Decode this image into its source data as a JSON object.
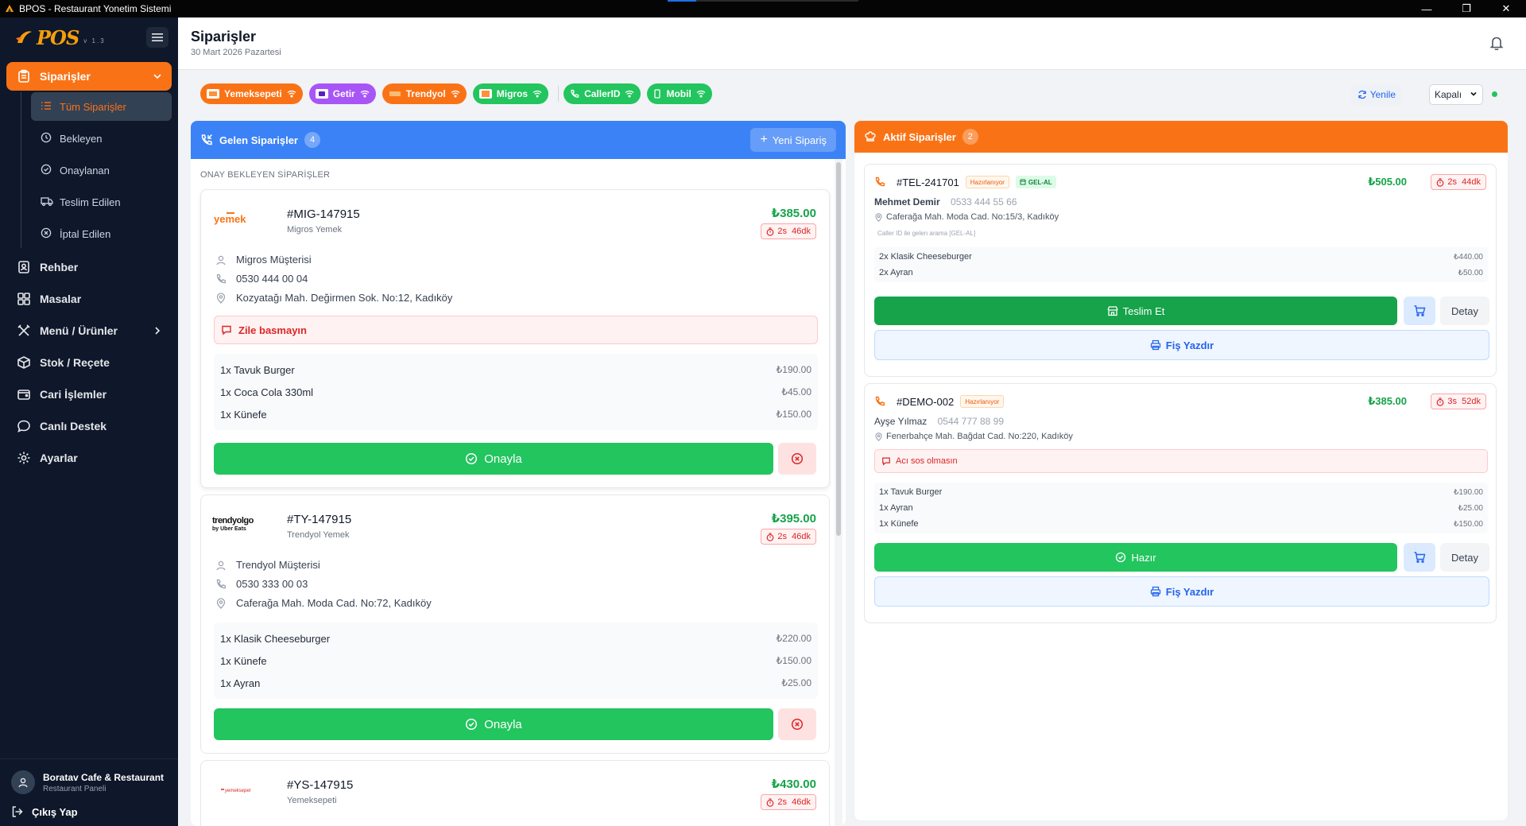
{
  "window": {
    "title": "BPOS - Restaurant Yonetim Sistemi",
    "load_progress": 0.15
  },
  "brand": {
    "logo": "POS",
    "version": "v 1.3"
  },
  "sidebar": {
    "items": [
      {
        "label": "Siparişler",
        "icon": "clipboard-icon",
        "active": true
      },
      {
        "label": "Rehber",
        "icon": "contact-book-icon"
      },
      {
        "label": "Masalar",
        "icon": "grid-icon"
      },
      {
        "label": "Menü / Ürünler",
        "icon": "utensils-icon"
      },
      {
        "label": "Stok / Reçete",
        "icon": "box-icon"
      },
      {
        "label": "Cari İşlemler",
        "icon": "wallet-icon"
      },
      {
        "label": "Canlı Destek",
        "icon": "chat-icon"
      },
      {
        "label": "Ayarlar",
        "icon": "gear-icon"
      }
    ],
    "subitems": [
      {
        "label": "Tüm Siparişler",
        "active": true
      },
      {
        "label": "Bekleyen"
      },
      {
        "label": "Onaylanan"
      },
      {
        "label": "Teslim Edilen"
      },
      {
        "label": "İptal Edilen"
      }
    ],
    "user": {
      "name": "Boratav Cafe & Restaurant",
      "role": "Restaurant Paneli"
    },
    "logout": "Çıkış Yap"
  },
  "header": {
    "title": "Siparişler",
    "date": "30 Mart 2026 Pazartesi"
  },
  "channels": [
    {
      "label": "Yemeksepeti",
      "color": "#f97316"
    },
    {
      "label": "Getir",
      "color": "#a855f7"
    },
    {
      "label": "Trendyol",
      "color": "#f97316"
    },
    {
      "label": "Migros",
      "color": "#22c55e"
    },
    {
      "label": "CallerID",
      "color": "#22c55e"
    },
    {
      "label": "Mobil",
      "color": "#22c55e"
    }
  ],
  "toolbar": {
    "refresh": "Yenile",
    "status": "Kapalı"
  },
  "incoming": {
    "title": "Gelen Siparişler",
    "count": "4",
    "new_order": "Yeni Sipariş",
    "section": "ONAY BEKLEYEN SİPARİŞLER",
    "approve_label": "Onayla",
    "orders": [
      {
        "logo": "yemek",
        "id": "#MIG-147915",
        "source": "Migros Yemek",
        "price": "₺385.00",
        "time": "2s  46dk",
        "customer": "Migros Müşterisi",
        "phone": "0530 444 00 04",
        "address": "Kozyatağı Mah. Değirmen Sok. No:12, Kadıköy",
        "note": "Zile basmayın",
        "items": [
          {
            "name": "1x Tavuk Burger",
            "price": "₺190.00"
          },
          {
            "name": "1x Coca Cola 330ml",
            "price": "₺45.00"
          },
          {
            "name": "1x Künefe",
            "price": "₺150.00"
          }
        ]
      },
      {
        "logo": "trendyolgo",
        "logo_sub": "by Uber Eats",
        "id": "#TY-147915",
        "source": "Trendyol Yemek",
        "price": "₺395.00",
        "time": "2s  46dk",
        "customer": "Trendyol Müşterisi",
        "phone": "0530 333 00 03",
        "address": "Caferağa Mah. Moda Cad. No:72, Kadıköy",
        "items": [
          {
            "name": "1x Klasik Cheeseburger",
            "price": "₺220.00"
          },
          {
            "name": "1x Künefe",
            "price": "₺150.00"
          },
          {
            "name": "1x Ayran",
            "price": "₺25.00"
          }
        ]
      },
      {
        "logo": "yemeksepeti",
        "id": "#YS-147915",
        "source": "Yemeksepeti",
        "price": "₺430.00",
        "time": "2s  46dk"
      }
    ]
  },
  "active": {
    "title": "Aktif Siparişler",
    "count": "2",
    "detail_label": "Detay",
    "print_label": "Fiş Yazdır",
    "orders": [
      {
        "id": "#TEL-241701",
        "status": "Hazırlanıyor",
        "tag": "GEL-AL",
        "price": "₺505.00",
        "time": "2s  44dk",
        "customer": "Mehmet Demir",
        "phone": "0533 444 55 66",
        "address": "Caferağa Mah. Moda Cad. No:15/3, Kadıköy",
        "caller_note": "Caller ID ile gelen arama [GEL-AL]",
        "items": [
          {
            "name": "2x Klasik Cheeseburger",
            "price": "₺440.00"
          },
          {
            "name": "2x Ayran",
            "price": "₺50.00"
          }
        ],
        "main_action": "Teslim Et"
      },
      {
        "id": "#DEMO-002",
        "status": "Hazırlanıyor",
        "price": "₺385.00",
        "time": "3s  52dk",
        "customer": "Ayşe Yılmaz",
        "phone": "0544 777 88 99",
        "address": "Fenerbahçe Mah. Bağdat Cad. No:220, Kadıköy",
        "note": "Acı sos olmasın",
        "items": [
          {
            "name": "1x Tavuk Burger",
            "price": "₺190.00"
          },
          {
            "name": "1x Ayran",
            "price": "₺25.00"
          },
          {
            "name": "1x Künefe",
            "price": "₺150.00"
          }
        ],
        "main_action": "Hazır"
      }
    ]
  }
}
